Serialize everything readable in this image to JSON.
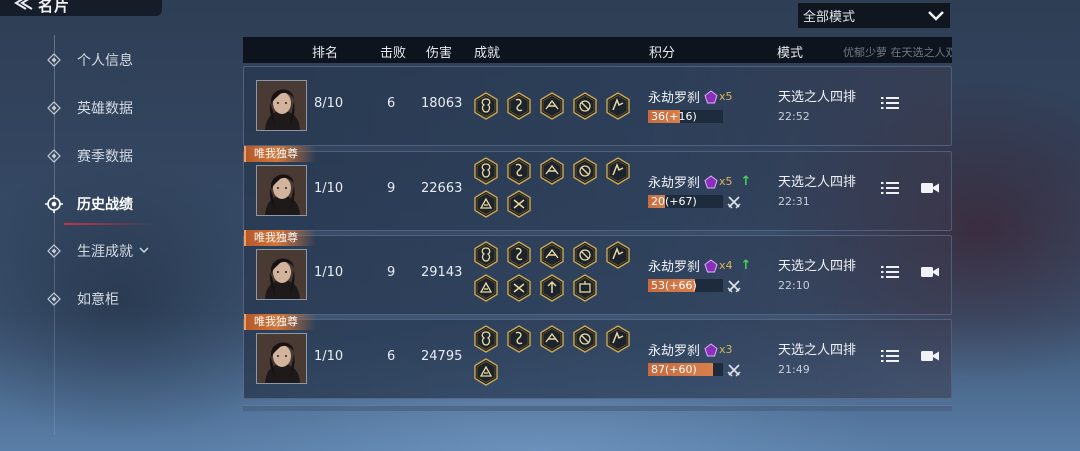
{
  "header": {
    "title": "名片"
  },
  "sidebar": {
    "items": [
      {
        "label": "个人信息",
        "active": false
      },
      {
        "label": "英雄数据",
        "active": false
      },
      {
        "label": "赛季数据",
        "active": false
      },
      {
        "label": "历史战绩",
        "active": true
      },
      {
        "label": "生涯成就",
        "active": false,
        "has_submenu": true
      },
      {
        "label": "如意柜",
        "active": false
      }
    ]
  },
  "mode_filter": {
    "selected": "全部模式"
  },
  "table": {
    "columns": [
      "排名",
      "击败",
      "伤害",
      "成就",
      "积分",
      "模式"
    ],
    "marquee": "优郁少萝 在天选之人双排中表现出类拔萃!",
    "rows": [
      {
        "badge": "",
        "rank": "8/10",
        "kills": "6",
        "damage": "18063",
        "achievements": [
          "ach-1",
          "ach-2",
          "ach-3",
          "ach-4",
          "ach-5"
        ],
        "tier": "永劫罗刹",
        "tier_mult": "x5",
        "tier_up": false,
        "score": "36(+16)",
        "score_progress": 0.42,
        "has_swords": false,
        "mode": "天选之人四排",
        "time": "22:52",
        "has_video": false
      },
      {
        "badge": "唯我独尊",
        "rank": "1/10",
        "kills": "9",
        "damage": "22663",
        "achievements": [
          "ach-1",
          "ach-2",
          "ach-3",
          "ach-4",
          "ach-5",
          "ach-6",
          "ach-7"
        ],
        "tier": "永劫罗刹",
        "tier_mult": "x5",
        "tier_up": true,
        "score": "20(+67)",
        "score_progress": 0.23,
        "has_swords": true,
        "mode": "天选之人四排",
        "time": "22:31",
        "has_video": true
      },
      {
        "badge": "唯我独尊",
        "rank": "1/10",
        "kills": "9",
        "damage": "29143",
        "achievements": [
          "ach-1",
          "ach-2",
          "ach-3",
          "ach-4",
          "ach-5",
          "ach-6",
          "ach-7",
          "ach-8",
          "ach-9"
        ],
        "tier": "永劫罗刹",
        "tier_mult": "x4",
        "tier_up": true,
        "score": "53(+66)",
        "score_progress": 0.62,
        "has_swords": true,
        "mode": "天选之人四排",
        "time": "22:10",
        "has_video": true
      },
      {
        "badge": "唯我独尊",
        "rank": "1/10",
        "kills": "6",
        "damage": "24795",
        "achievements": [
          "ach-1",
          "ach-2",
          "ach-3",
          "ach-4",
          "ach-5",
          "ach-6"
        ],
        "tier": "永劫罗刹",
        "tier_mult": "x3",
        "tier_up": false,
        "score": "87(+60)",
        "score_progress": 0.87,
        "has_swords": true,
        "mode": "天选之人四排",
        "time": "21:49",
        "has_video": true
      }
    ]
  },
  "colors": {
    "accent_red": "#d2324a",
    "badge_orange": "#d2763a",
    "progress_fill": "#d97f4b",
    "up_arrow": "#3fd35a",
    "gem_purple": "#8a2fb8",
    "gold": "#d8b45a"
  }
}
